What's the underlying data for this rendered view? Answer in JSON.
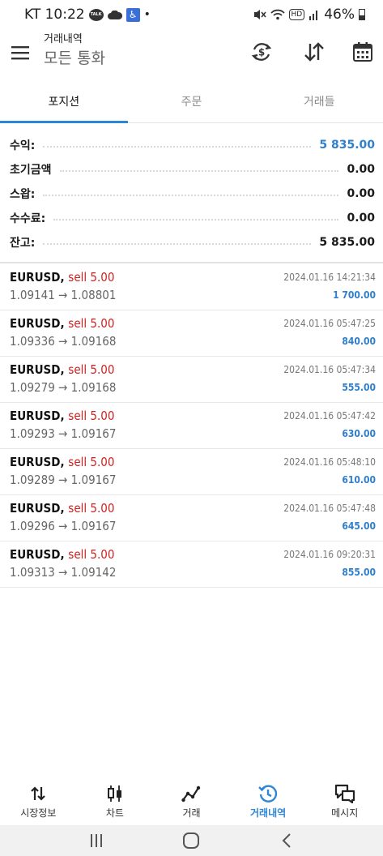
{
  "status_bar": {
    "time_text": "KT 10:22",
    "battery_text": "46%",
    "icons": [
      "kakaotalk-icon",
      "cloud-icon",
      "accessibility-icon",
      "dot-icon",
      "mute-icon",
      "wifi-icon",
      "hd-icon",
      "signal-icon",
      "battery-icon"
    ]
  },
  "header": {
    "title": "거래내역",
    "subtitle": "모든 통화",
    "icons": [
      "menu-icon",
      "currency-refresh-icon",
      "sort-icon",
      "calendar-icon"
    ]
  },
  "tabs": [
    {
      "label": "포지션",
      "active": true
    },
    {
      "label": "주문",
      "active": false
    },
    {
      "label": "거래들",
      "active": false
    }
  ],
  "summary": {
    "rows": [
      {
        "label": "수익:",
        "value": "5 835.00",
        "highlight": true
      },
      {
        "label": "초기금액",
        "value": "0.00",
        "highlight": false
      },
      {
        "label": "스왑:",
        "value": "0.00",
        "highlight": false
      },
      {
        "label": "수수료:",
        "value": "0.00",
        "highlight": false
      },
      {
        "label": "잔고:",
        "value": "5 835.00",
        "highlight": false
      }
    ]
  },
  "deals": [
    {
      "symbol": "EURUSD,",
      "side": "sell 5.00",
      "prices": "1.09141 → 1.08801",
      "time": "2024.01.16 14:21:34",
      "profit": "1 700.00"
    },
    {
      "symbol": "EURUSD,",
      "side": "sell 5.00",
      "prices": "1.09336 → 1.09168",
      "time": "2024.01.16 05:47:25",
      "profit": "840.00"
    },
    {
      "symbol": "EURUSD,",
      "side": "sell 5.00",
      "prices": "1.09279 → 1.09168",
      "time": "2024.01.16 05:47:34",
      "profit": "555.00"
    },
    {
      "symbol": "EURUSD,",
      "side": "sell 5.00",
      "prices": "1.09293 → 1.09167",
      "time": "2024.01.16 05:47:42",
      "profit": "630.00"
    },
    {
      "symbol": "EURUSD,",
      "side": "sell 5.00",
      "prices": "1.09289 → 1.09167",
      "time": "2024.01.16 05:48:10",
      "profit": "610.00"
    },
    {
      "symbol": "EURUSD,",
      "side": "sell 5.00",
      "prices": "1.09296 → 1.09167",
      "time": "2024.01.16 05:47:48",
      "profit": "645.00"
    },
    {
      "symbol": "EURUSD,",
      "side": "sell 5.00",
      "prices": "1.09313 → 1.09142",
      "time": "2024.01.16 09:20:31",
      "profit": "855.00"
    }
  ],
  "bottom_nav": [
    {
      "label": "시장정보",
      "icon": "quotes-arrows-icon",
      "active": false
    },
    {
      "label": "차트",
      "icon": "candlestick-icon",
      "active": false
    },
    {
      "label": "거래",
      "icon": "trade-line-icon",
      "active": false
    },
    {
      "label": "거래내역",
      "icon": "history-clock-icon",
      "active": true
    },
    {
      "label": "메시지",
      "icon": "messages-icon",
      "active": false
    }
  ],
  "system_nav": {
    "icons": [
      "recent-apps-icon",
      "home-icon",
      "back-icon"
    ]
  },
  "colors": {
    "accent_blue": "#2f86d6",
    "profit_blue": "#2f7fcc",
    "sell_red": "#d02020",
    "nav_bar_bg": "#f1f1f1"
  }
}
